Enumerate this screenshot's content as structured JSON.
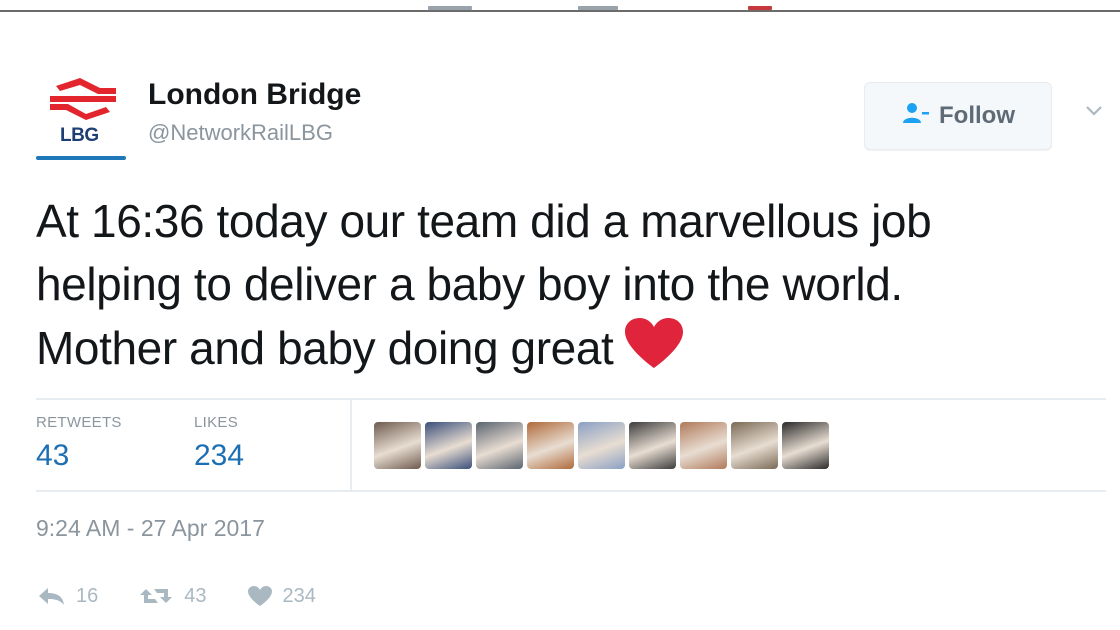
{
  "account": {
    "logo_text": "LBG",
    "display_name": "London Bridge",
    "handle": "@NetworkRailLBG"
  },
  "follow_button": {
    "label": "Follow",
    "icon": "follow-user-icon"
  },
  "tweet": {
    "line1": "At 16:36 today our team did a marvellous job",
    "line2": "helping to deliver a baby boy into the world.",
    "line3": "Mother and baby doing great",
    "emoji": "red-heart-icon"
  },
  "stats": {
    "retweets_label": "RETWEETS",
    "retweets_count": "43",
    "likes_label": "LIKES",
    "likes_count": "234"
  },
  "likers": [
    {
      "name": "liker-1",
      "color": "#6e5a4e"
    },
    {
      "name": "liker-2",
      "color": "#3a4f7a"
    },
    {
      "name": "liker-3",
      "color": "#5a6470"
    },
    {
      "name": "liker-4",
      "color": "#b06a3a"
    },
    {
      "name": "liker-5",
      "color": "#8aa0c4"
    },
    {
      "name": "liker-6",
      "color": "#3c3c3c"
    },
    {
      "name": "liker-7",
      "color": "#b07a5a"
    },
    {
      "name": "liker-8",
      "color": "#7a6a55"
    },
    {
      "name": "liker-9",
      "color": "#2a2a2a"
    }
  ],
  "timestamp": "9:24 AM - 27 Apr 2017",
  "actions": {
    "reply_count": "16",
    "retweet_count": "43",
    "like_count": "234"
  },
  "colors": {
    "heart": "#e0243c",
    "logo_red": "#e3262d",
    "logo_blue": "#1d3f74",
    "link_blue": "#1b6fb2"
  }
}
